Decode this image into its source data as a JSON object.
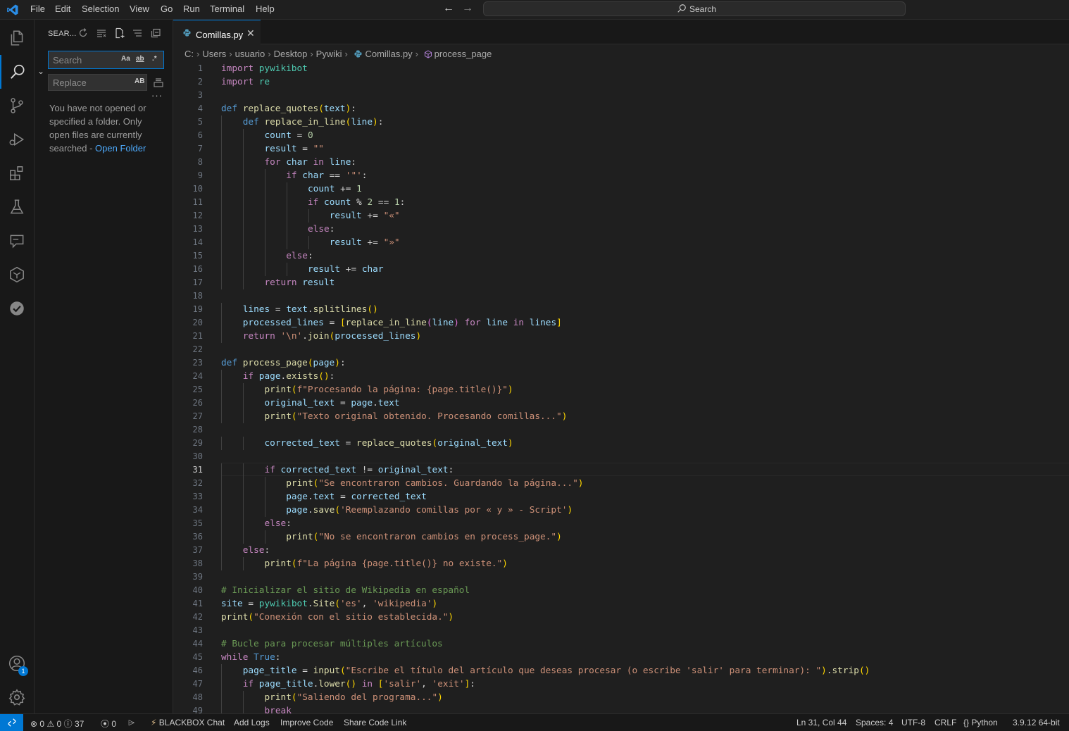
{
  "menu": [
    "File",
    "Edit",
    "Selection",
    "View",
    "Go",
    "Run",
    "Terminal",
    "Help"
  ],
  "command_center": {
    "label": "Search"
  },
  "activity_bar": {
    "items": [
      "explorer",
      "search",
      "source-control",
      "run-and-debug",
      "extensions",
      "testing",
      "chat",
      "blackbox",
      "tasks"
    ],
    "accounts_badge": "1"
  },
  "sidebar": {
    "title": "SEAR...",
    "search_placeholder": "Search",
    "search_options": [
      "Aa",
      "ab",
      ".*"
    ],
    "replace_placeholder": "Replace",
    "preserve_case": "AB",
    "message_prefix": "You have not opened or specified a folder. Only open files are currently searched - ",
    "open_folder_link": "Open Folder"
  },
  "tab": {
    "label": "Comillas.py"
  },
  "breadcrumb": [
    "C:",
    "Users",
    "usuario",
    "Desktop",
    "Pywiki",
    "Comillas.py",
    "process_page"
  ],
  "editor": {
    "active_line": 31,
    "lines": [
      "import pywikibot",
      "import re",
      "",
      "def replace_quotes(text):",
      "    def replace_in_line(line):",
      "        count = 0",
      "        result = \"\"",
      "        for char in line:",
      "            if char == '\"':",
      "                count += 1",
      "                if count % 2 == 1:",
      "                    result += \"«\"",
      "                else:",
      "                    result += \"»\"",
      "            else:",
      "                result += char",
      "        return result",
      "",
      "    lines = text.splitlines()",
      "    processed_lines = [replace_in_line(line) for line in lines]",
      "    return '\\n'.join(processed_lines)",
      "",
      "def process_page(page):",
      "    if page.exists():",
      "        print(f\"Procesando la página: {page.title()}\")",
      "        original_text = page.text",
      "        print(\"Texto original obtenido. Procesando comillas...\")",
      "",
      "        corrected_text = replace_quotes(original_text)",
      "",
      "        if corrected_text != original_text:",
      "            print(\"Se encontraron cambios. Guardando la página...\")",
      "            page.text = corrected_text",
      "            page.save('Reemplazando comillas por « y » - Script')",
      "        else:",
      "            print(\"No se encontraron cambios en process_page.\")",
      "    else:",
      "        print(f\"La página {page.title()} no existe.\")",
      "",
      "# Inicializar el sitio de Wikipedia en español",
      "site = pywikibot.Site('es', 'wikipedia')",
      "print(\"Conexión con el sitio establecida.\")",
      "",
      "# Bucle para procesar múltiples artículos",
      "while True:",
      "    page_title = input(\"Escribe el título del artículo que deseas procesar (o escribe 'salir' para terminar): \").strip()",
      "    if page_title.lower() in ['salir', 'exit']:",
      "        print(\"Saliendo del programa...\")",
      "        break"
    ]
  },
  "statusbar": {
    "errors": "0",
    "warnings": "0",
    "infos": "37",
    "ports": "0",
    "blackbox_chat": "BLACKBOX Chat",
    "add_logs": "Add Logs",
    "improve_code": "Improve Code",
    "share_code_link": "Share Code Link",
    "cursor_position": "Ln 31, Col 44",
    "spaces": "Spaces: 4",
    "encoding": "UTF-8",
    "eol": "CRLF",
    "language": "Python",
    "interpreter": "3.9.12 64-bit"
  },
  "colors": {
    "accent": "#0078d4",
    "keyword": "#c586c0",
    "def": "#569cd6",
    "function": "#dcdcaa",
    "variable": "#9cdcfe",
    "string": "#ce9178",
    "number": "#b5cea8",
    "comment": "#6a9955"
  }
}
